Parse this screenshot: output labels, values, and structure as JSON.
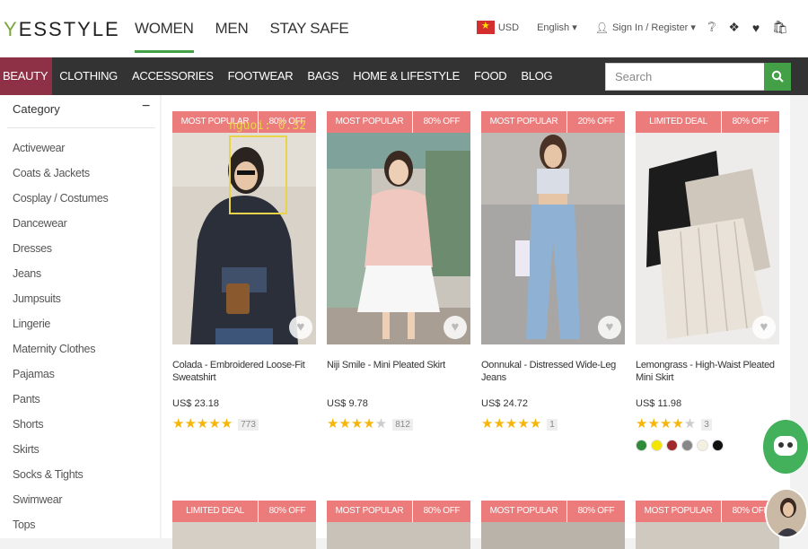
{
  "header": {
    "logo": "YESSTYLE",
    "nav": [
      "WOMEN",
      "MEN",
      "STAY SAFE"
    ],
    "currency": "USD",
    "language": "English ▾",
    "account": "Sign In / Register ▾"
  },
  "catbar": {
    "items": [
      "BEAUTY",
      "CLOTHING",
      "ACCESSORIES",
      "FOOTWEAR",
      "BAGS",
      "HOME & LIFESTYLE",
      "FOOD",
      "BLOG"
    ],
    "search_placeholder": "Search"
  },
  "sidebar": {
    "title": "Category",
    "items": [
      "Activewear",
      "Coats & Jackets",
      "Cosplay / Costumes",
      "Dancewear",
      "Dresses",
      "Jeans",
      "Jumpsuits",
      "Lingerie",
      "Maternity Clothes",
      "Pajamas",
      "Pants",
      "Shorts",
      "Skirts",
      "Socks & Tights",
      "Swimwear",
      "Tops"
    ]
  },
  "products": [
    {
      "badge": "MOST POPULAR",
      "discount": "80% OFF",
      "name": "Colada - Embroidered Loose-Fit Sweatshirt",
      "price": "US$ 23.18",
      "rating": 5,
      "reviews": "773"
    },
    {
      "badge": "MOST POPULAR",
      "discount": "80% OFF",
      "name": "Niji Smile - Mini Pleated Skirt",
      "price": "US$ 9.78",
      "rating": 4,
      "reviews": "812"
    },
    {
      "badge": "MOST POPULAR",
      "discount": "20% OFF",
      "name": "Oonnukal - Distressed Wide-Leg Jeans",
      "price": "US$ 24.72",
      "rating": 5,
      "reviews": "1"
    },
    {
      "badge": "LIMITED DEAL",
      "discount": "80% OFF",
      "name": "Lemongrass - High-Waist Pleated Mini Skirt",
      "price": "US$ 11.98",
      "rating": 4,
      "reviews": "3",
      "swatches": [
        "#2e8b3a",
        "#f2e500",
        "#a02a2a",
        "#888888",
        "#f4f0e0",
        "#111111"
      ]
    }
  ],
  "products_row2": [
    {
      "badge": "LIMITED DEAL",
      "discount": "80% OFF"
    },
    {
      "badge": "MOST POPULAR",
      "discount": "80% OFF"
    },
    {
      "badge": "MOST POPULAR",
      "discount": "80% OFF"
    },
    {
      "badge": "MOST POPULAR",
      "discount": "80% OFF"
    }
  ],
  "detection": {
    "label": "nguoi: 0.32",
    "color": "#e8d34a"
  },
  "colors": {
    "accent": "#43a047",
    "badge": "#ec7b7b",
    "active_tab": "#8e3147",
    "star": "#f5b50a"
  }
}
